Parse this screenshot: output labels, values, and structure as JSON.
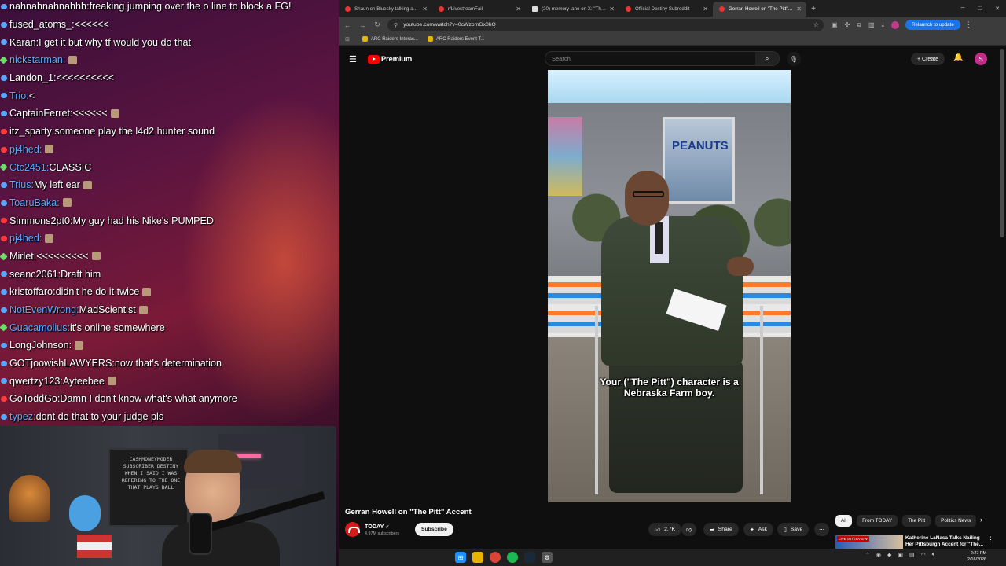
{
  "chat": {
    "messages": [
      {
        "user": "nahnahnahnahhh",
        "sep": ": ",
        "text": "freaking jumping over the o line to block a FG!",
        "color": "white",
        "badge": "blue",
        "emote": false
      },
      {
        "user": "fused_atoms_",
        "sep": ": ",
        "text": "<<<<<<",
        "color": "white",
        "badge": "blue",
        "emote": false
      },
      {
        "user": "Karan",
        "sep": ": ",
        "text": "I get it but why tf would you do that",
        "color": "white",
        "badge": "blue",
        "emote": false
      },
      {
        "user": "nickstarman",
        "sep": ": ",
        "text": "",
        "color": "blue",
        "badge": "green",
        "emote": true
      },
      {
        "user": "Landon_1",
        "sep": ": ",
        "text": "<<<<<<<<<<",
        "color": "white",
        "badge": "blue",
        "emote": false
      },
      {
        "user": "Trio",
        "sep": ": ",
        "text": "<",
        "color": "blue",
        "badge": "blue",
        "emote": false
      },
      {
        "user": "CaptainFerret",
        "sep": ": ",
        "text": "<<<<<<",
        "color": "white",
        "badge": "blue",
        "emote": true
      },
      {
        "user": "itz_sparty",
        "sep": ": ",
        "text": "someone play the l4d2 hunter sound",
        "color": "white",
        "badge": "red",
        "emote": false
      },
      {
        "user": "pj4hed",
        "sep": ": ",
        "text": "",
        "color": "blue",
        "badge": "red",
        "emote": true
      },
      {
        "user": "Ctc2451",
        "sep": ": ",
        "text": "CLASSIC",
        "color": "blue",
        "badge": "green",
        "emote": false
      },
      {
        "user": "Trius",
        "sep": ": ",
        "text": "My left ear",
        "color": "blue",
        "badge": "blue",
        "emote": true
      },
      {
        "user": "ToaruBaka",
        "sep": ": ",
        "text": "",
        "color": "blue",
        "badge": "blue",
        "emote": true
      },
      {
        "user": "Simmons2pt0",
        "sep": ": ",
        "text": "My guy had his Nike's PUMPED",
        "color": "white",
        "badge": "red",
        "emote": false
      },
      {
        "user": "pj4hed",
        "sep": ": ",
        "text": "",
        "color": "blue",
        "badge": "red",
        "emote": true
      },
      {
        "user": "Mirlet",
        "sep": ": ",
        "text": "<<<<<<<<<",
        "color": "white",
        "badge": "green",
        "emote": true
      },
      {
        "user": "seanc2061",
        "sep": ": ",
        "text": "Draft him",
        "color": "white",
        "badge": "blue",
        "emote": false
      },
      {
        "user": "kristoffaro",
        "sep": ": ",
        "text": "didn't he do it twice",
        "color": "white",
        "badge": "blue",
        "emote": true
      },
      {
        "user": "NotEvenWrong",
        "sep": ": ",
        "text": "MadScientist",
        "color": "blue",
        "badge": "blue",
        "emote": true
      },
      {
        "user": "Guacamolius",
        "sep": ": ",
        "text": "it's online somewhere",
        "color": "blue",
        "badge": "green",
        "emote": false
      },
      {
        "user": "LongJohnson",
        "sep": ": ",
        "text": "",
        "color": "white",
        "badge": "blue",
        "emote": true
      },
      {
        "user": "GOTjoowishLAWYERS",
        "sep": ": ",
        "text": "now that's determination",
        "color": "white",
        "badge": "blue",
        "emote": false
      },
      {
        "user": "qwertzy123",
        "sep": ": ",
        "text": "Ayteebee",
        "color": "white",
        "badge": "blue",
        "emote": true
      },
      {
        "user": "GoToddGo",
        "sep": ": ",
        "text": "Damn I don't know what's what anymore",
        "color": "white",
        "badge": "red",
        "emote": false
      },
      {
        "user": "typez",
        "sep": ": ",
        "text": "dont do that to your judge pls",
        "color": "blue",
        "badge": "blue",
        "emote": false
      }
    ]
  },
  "webcam": {
    "frame_text": "CASHMONEYMODER SUBSCRIBER DESTINY WHEN I SAID I WAS REFERING TO THE ONE THAT PLAYS BALL"
  },
  "browser": {
    "tabs": [
      {
        "label": "Shaun on Bluesky talking abou",
        "active": false,
        "icon": "reddit-icon"
      },
      {
        "label": "r/LivestreamFail",
        "active": false,
        "icon": "reddit-icon"
      },
      {
        "label": "(20) memory lane on X: \"This i",
        "active": false,
        "icon": "x-icon"
      },
      {
        "label": "Official Destiny Subreddit",
        "active": false,
        "icon": "reddit-icon"
      },
      {
        "label": "Gerran Howell on \"The Pitt\" Ac",
        "active": true,
        "icon": "youtube-icon"
      }
    ],
    "new_tab": "+",
    "url": "youtube.com/watch?v=0cWzbmGx0hQ",
    "relaunch_label": "Relaunch to update",
    "bookmarks": [
      {
        "label": "ARC Raiders Interac..."
      },
      {
        "label": "ARC Raiders Event T..."
      }
    ]
  },
  "youtube": {
    "logo_text": "Premium",
    "search_placeholder": "Search",
    "create_label": "Create",
    "avatar_letter": "S",
    "caption_line1": "Your (\"The Pitt\") character is a",
    "caption_line2": "Nebraska Farm boy.",
    "video_sign": "PEANUTS",
    "title": "Gerran Howell on \"The Pitt\" Accent",
    "channel": "TODAY",
    "subscribers": "4.97M subscribers",
    "subscribe_label": "Subscribe",
    "likes": "2.7K",
    "share_label": "Share",
    "ask_label": "Ask",
    "save_label": "Save",
    "chips": [
      "All",
      "From TODAY",
      "The Pitt",
      "Politics News"
    ],
    "rec_title": "Katherine LaNasa Talks Nailing Her Pittsburgh Accent for \"The...",
    "rec_badge": "LIVE INTERVIEW"
  },
  "taskbar": {
    "time": "2:27 PM",
    "date": "2/16/2026"
  },
  "colors": {
    "accent": "#1a73e8",
    "youtube_red": "#ff0000",
    "chat_blue": "#5aa9ff"
  }
}
